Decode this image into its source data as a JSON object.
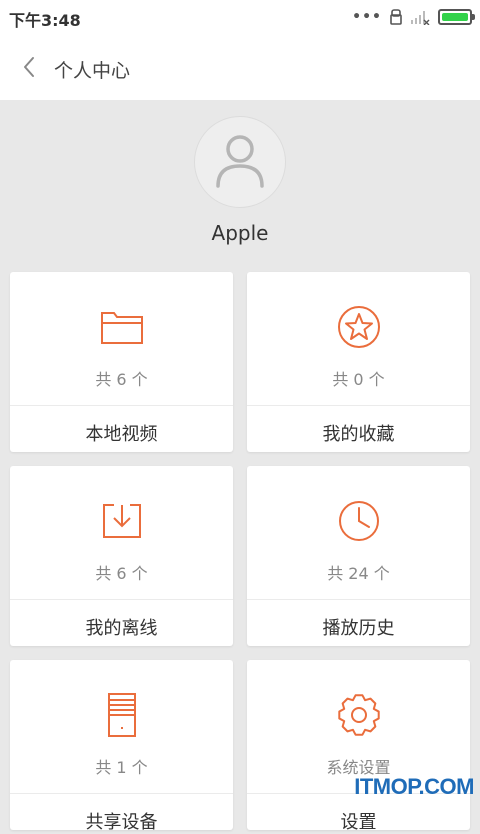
{
  "status_bar": {
    "time": "下午3:48",
    "more_indicator": "•••",
    "battery_level": 1.0,
    "battery_color": "#32d24a",
    "icons": [
      "more-dots-icon",
      "sim-lock-icon",
      "signal-off-icon",
      "battery-icon"
    ]
  },
  "header": {
    "title": "个人中心",
    "back_icon": "chevron-left-icon"
  },
  "profile": {
    "username": "Apple",
    "avatar_icon": "user-silhouette-icon"
  },
  "accent_color": "#ea6d3c",
  "cards": {
    "local_videos": {
      "count": "共 6 个",
      "label": "本地视频",
      "icon": "folder-icon"
    },
    "favorites": {
      "count": "共 0 个",
      "label": "我的收藏",
      "icon": "star-icon"
    },
    "offline": {
      "count": "共 6 个",
      "label": "我的离线",
      "icon": "download-icon"
    },
    "history": {
      "count": "共 24 个",
      "label": "播放历史",
      "icon": "clock-icon"
    },
    "shared_devices": {
      "count": "共 1 个",
      "label": "共享设备",
      "icon": "storage-device-icon"
    },
    "settings": {
      "count": "系统设置",
      "label": "设置",
      "icon": "gear-icon"
    }
  },
  "watermark": "ITMOP.COM"
}
